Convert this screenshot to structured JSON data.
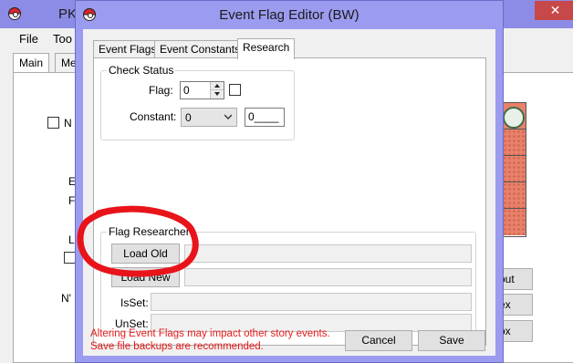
{
  "background_window": {
    "title": "PK",
    "menu": [
      "File",
      "Too"
    ],
    "tabs": [
      "Main",
      "Me"
    ],
    "fragments": {
      "n1": "N",
      "e": "E",
      "f": "F",
      "l": "L",
      "ns": "N'"
    },
    "buttons": {
      "b1": "out",
      "b2": "ex",
      "b3": "ox"
    }
  },
  "dialog": {
    "title": "Event Flag Editor (BW)",
    "close_glyph": "✕",
    "tabs": [
      "Event Flags",
      "Event Constants",
      "Research"
    ],
    "active_tab": "Research",
    "check_status": {
      "group_title": "Check Status",
      "flag_label": "Flag:",
      "flag_value": "0",
      "constant_label": "Constant:",
      "constant_selected": "0",
      "constant_value": "0____"
    },
    "researcher": {
      "group_title": "Flag Researcher",
      "load_old_label": "Load Old",
      "load_new_label": "Load New",
      "isset_label": "IsSet:",
      "unset_label": "UnSet:"
    },
    "warning_line1": "Altering Event Flags may impact other story events.",
    "warning_line2": "Save file backups are recommended.",
    "cancel_label": "Cancel",
    "save_label": "Save"
  },
  "colors": {
    "title_bar": "#9b9bf0",
    "close_button": "#c74848",
    "warning_text": "#e51b1b",
    "annotation": "#e8141a"
  },
  "annotation": "red-circle-around-load-buttons"
}
